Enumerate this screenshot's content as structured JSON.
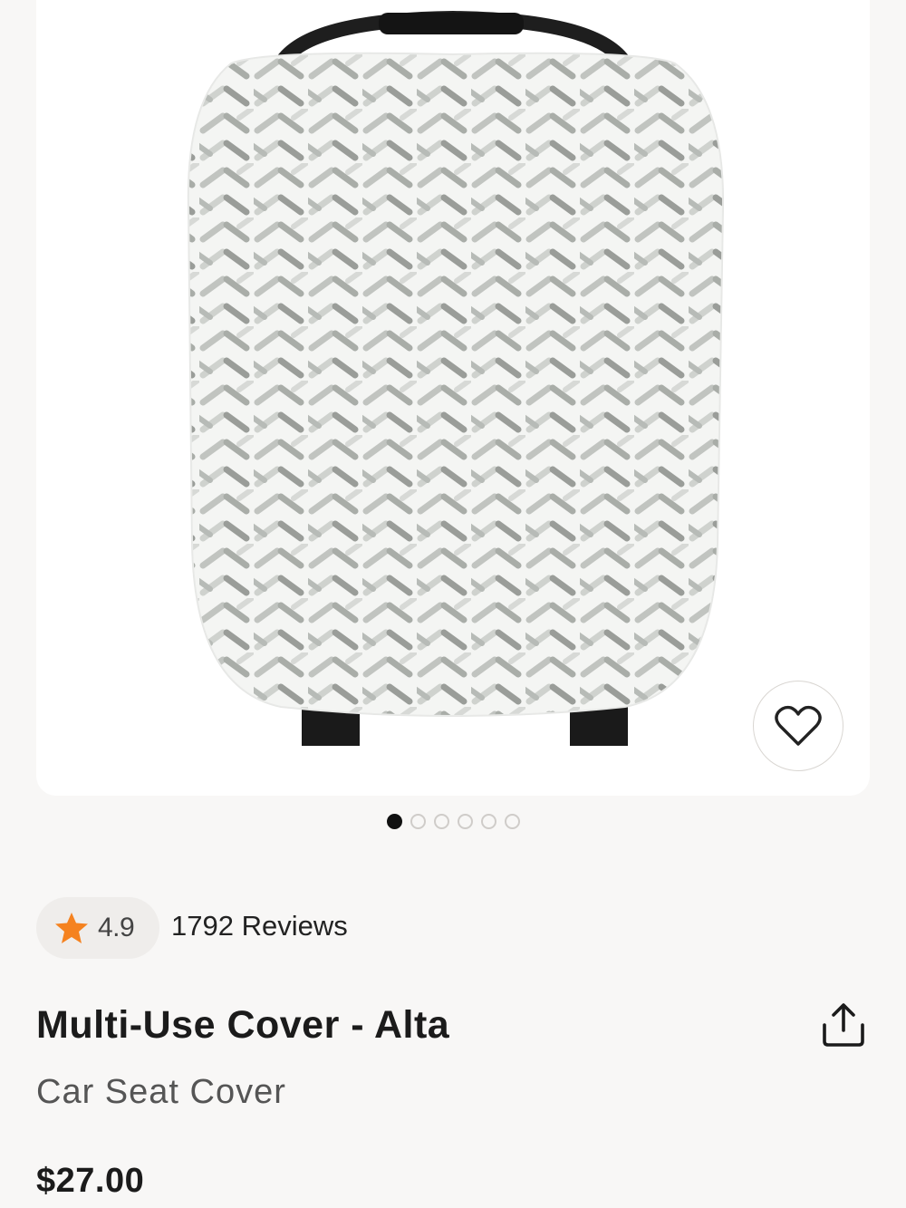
{
  "product": {
    "title": "Multi-Use Cover - Alta",
    "subtitle": "Car Seat Cover",
    "price": "$27.00"
  },
  "rating": {
    "value": "4.9",
    "reviews_label": "1792 Reviews",
    "star_color": "#f5821f"
  },
  "gallery": {
    "image_count": 6,
    "active_index": 0
  },
  "icons": {
    "favorite": "heart-outline-icon",
    "share": "share-icon",
    "rating": "star-icon"
  }
}
